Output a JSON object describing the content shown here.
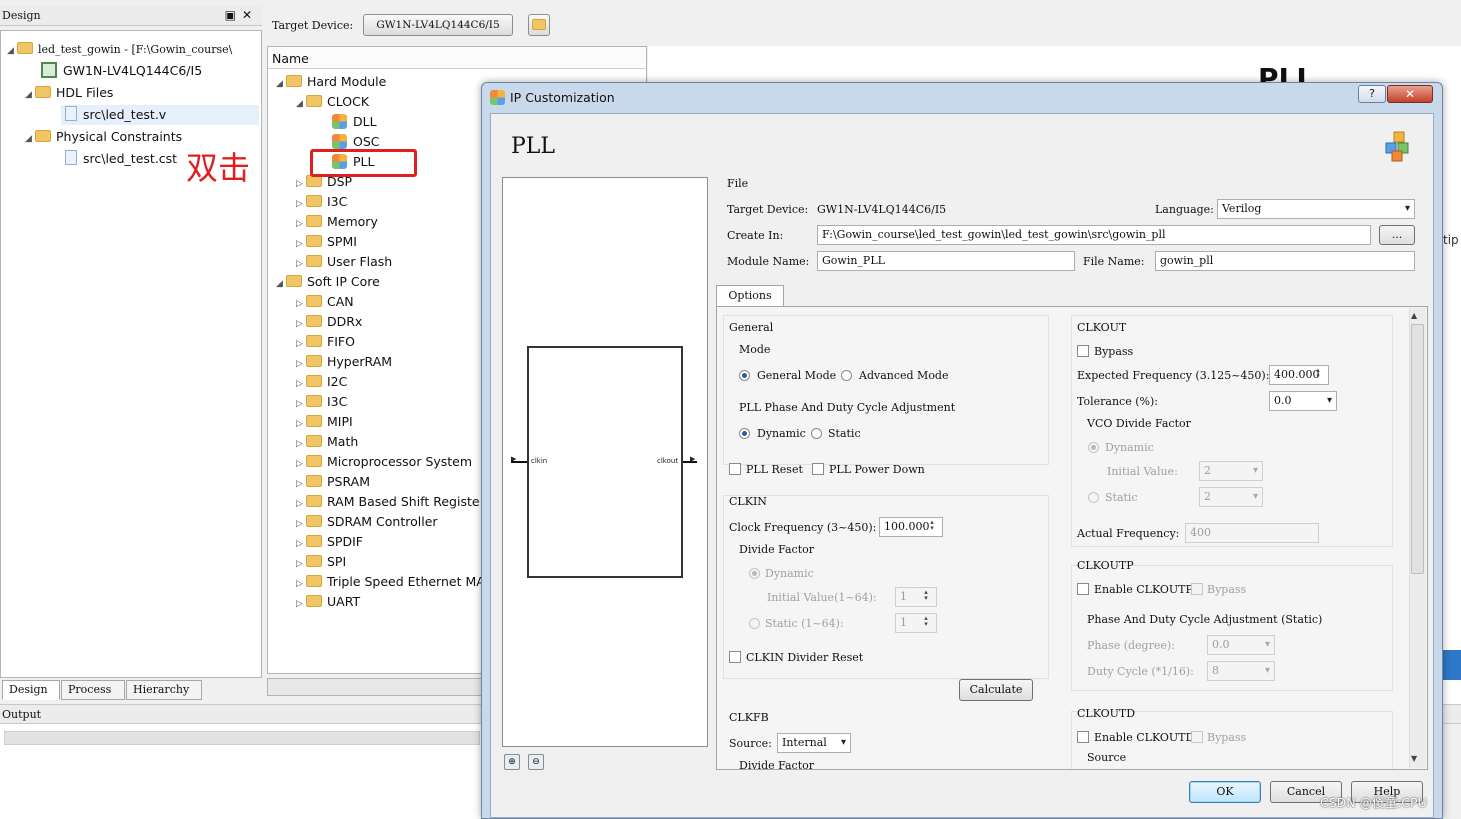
{
  "design_panel": {
    "title": "Design",
    "tree": {
      "project": "led_test_gowin - [F:\\Gowin_course\\",
      "device": "GW1N-LV4LQ144C6/I5",
      "hdl_files": "HDL Files",
      "hdl_file": "src\\led_test.v",
      "constraints": "Physical Constraints",
      "cst_file": "src\\led_test.cst"
    },
    "annotation": "双击",
    "tabs": [
      "Design",
      "Process",
      "Hierarchy"
    ]
  },
  "toolbar": {
    "target_label": "Target Device:",
    "target_value": "GW1N-LV4LQ144C6/I5"
  },
  "ip_tree": {
    "header": "Name",
    "hard_module": "Hard Module",
    "clock": "CLOCK",
    "clock_items": [
      "DLL",
      "OSC",
      "PLL"
    ],
    "hard_rest": [
      "DSP",
      "I3C",
      "Memory",
      "SPMI",
      "User Flash"
    ],
    "soft_ip": "Soft IP Core",
    "soft_items": [
      "CAN",
      "DDRx",
      "FIFO",
      "HyperRAM",
      "I2C",
      "I3C",
      "MIPI",
      "Math",
      "Microprocessor System",
      "PSRAM",
      "RAM Based Shift Registe",
      "SDRAM Controller",
      "SPDIF",
      "SPI",
      "Triple Speed Ethernet MA",
      "UART"
    ]
  },
  "output": {
    "title": "Output"
  },
  "background": {
    "pll_text": "PLL",
    "tip_text": "tip"
  },
  "dialog": {
    "title": "IP Customization",
    "help": "?",
    "close": "✕",
    "heading": "PLL",
    "preview": {
      "pin_in": "clkin",
      "pin_out": "clkout"
    },
    "file": {
      "section": "File",
      "target_label": "Target Device:",
      "target_value": "GW1N-LV4LQ144C6/I5",
      "language_label": "Language:",
      "language_value": "Verilog",
      "create_label": "Create In:",
      "create_value": "F:\\Gowin_course\\led_test_gowin\\led_test_gowin\\src\\gowin_pll",
      "browse": "...",
      "module_label": "Module Name:",
      "module_value": "Gowin_PLL",
      "filename_label": "File Name:",
      "filename_value": "gowin_pll"
    },
    "tab": "Options",
    "general": {
      "title": "General",
      "mode_title": "Mode",
      "mode_general": "General Mode",
      "mode_advanced": "Advanced Mode",
      "phase_title": "PLL Phase And Duty Cycle Adjustment",
      "dynamic": "Dynamic",
      "static": "Static",
      "pll_reset": "PLL Reset",
      "pll_power_down": "PLL Power Down"
    },
    "clkin": {
      "title": "CLKIN",
      "freq_label": "Clock Frequency (3~450):",
      "freq_value": "100.000",
      "divide_title": "Divide Factor",
      "dynamic": "Dynamic",
      "initial_label": "Initial Value(1~64):",
      "initial_value": "1",
      "static_label": "Static (1~64):",
      "static_value": "1",
      "divider_reset": "CLKIN Divider Reset",
      "calculate": "Calculate"
    },
    "clkfb": {
      "title": "CLKFB",
      "source_label": "Source:",
      "source_value": "Internal",
      "divide_title": "Divide Factor"
    },
    "clkout": {
      "title": "CLKOUT",
      "bypass": "Bypass",
      "expected_label": "Expected Frequency (3.125~450):",
      "expected_value": "400.000",
      "tolerance_label": "Tolerance (%):",
      "tolerance_value": "0.0",
      "vco_title": "VCO Divide Factor",
      "dynamic": "Dynamic",
      "initial_label": "Initial Value:",
      "initial_value": "2",
      "static_label": "Static",
      "static_value": "2",
      "actual_label": "Actual Frequency:",
      "actual_value": "400"
    },
    "clkoutp": {
      "title": "CLKOUTP",
      "enable": "Enable CLKOUTP",
      "bypass": "Bypass",
      "phase_title": "Phase And Duty Cycle Adjustment (Static)",
      "phase_label": "Phase (degree):",
      "phase_value": "0.0",
      "duty_label": "Duty Cycle (*1/16):",
      "duty_value": "8"
    },
    "clkoutd": {
      "title": "CLKOUTD",
      "enable": "Enable CLKOUTD",
      "bypass": "Bypass",
      "source": "Source"
    },
    "buttons": {
      "ok": "OK",
      "cancel": "Cancel",
      "help": "Help"
    }
  },
  "watermark": "CSDN @傻童:CPU"
}
